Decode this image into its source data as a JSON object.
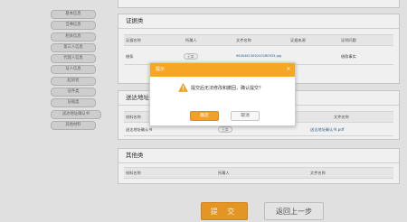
{
  "sidebar": {
    "items": [
      {
        "label": "基本信息"
      },
      {
        "label": "当事信息"
      },
      {
        "label": "相关信息"
      },
      {
        "label": "第三人信息"
      },
      {
        "label": "代理人信息"
      },
      {
        "label": "证人信息"
      },
      {
        "label": "起诉状"
      },
      {
        "label": "证件类"
      },
      {
        "label": "证据类"
      },
      {
        "label": "送达地址确认书"
      },
      {
        "label": "其他材料"
      }
    ]
  },
  "evidence": {
    "title": "证据类",
    "headers": [
      "证据名称",
      "所属人",
      "文件名称",
      "证据来源",
      "证明问题"
    ],
    "row": {
      "name": "借条",
      "owner": "王某",
      "file": "9640481360243280933.jpg",
      "source": "",
      "proves": "借款事实"
    }
  },
  "address": {
    "title": "送达地址",
    "headers": [
      "材料名称",
      "",
      "",
      "文件名称"
    ],
    "row": {
      "name": "送达地址确认书",
      "owner": "王某",
      "file": "送达地址确认书.pdf"
    }
  },
  "other": {
    "title": "其他类",
    "headers": [
      "材料名称",
      "所属人",
      "文件名称"
    ]
  },
  "buttons": {
    "submit": "提 交",
    "back": "返回上一步"
  },
  "dialog": {
    "title": "提示",
    "message": "提交后无法修改和撤回，确认提交？",
    "ok": "确定",
    "cancel": "取消",
    "close": "×"
  },
  "colors": {
    "accent": "#f5a623",
    "button_orange": "#f3a027"
  }
}
